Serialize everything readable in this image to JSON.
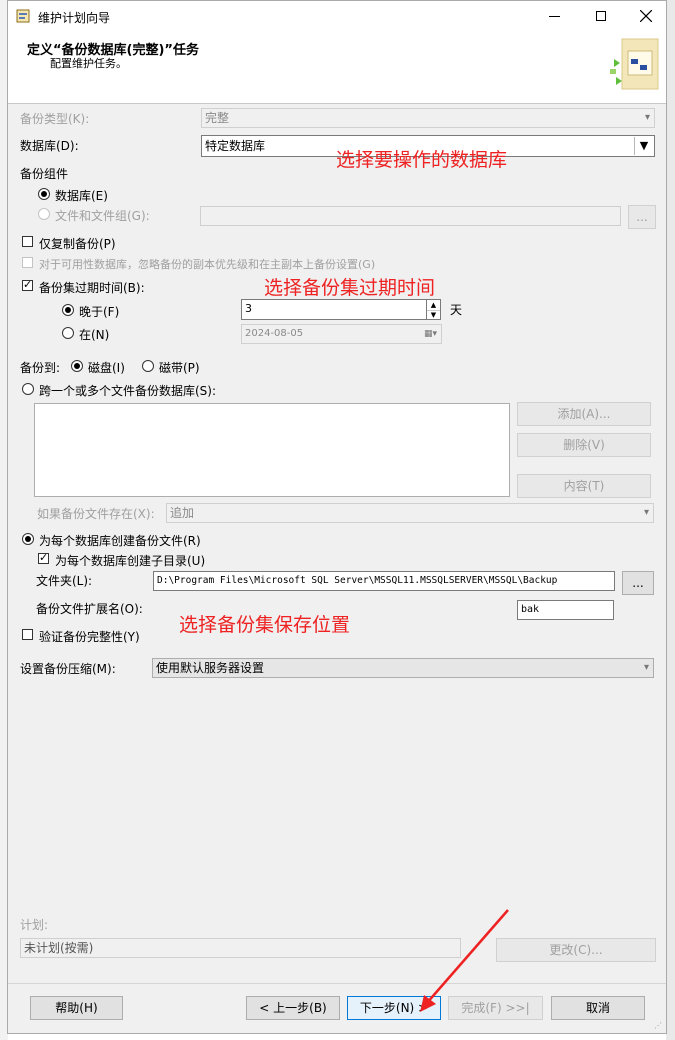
{
  "window": {
    "title": "维护计划向导",
    "header_title": "定义“备份数据库(完整)”任务",
    "header_subtitle": "配置维护任务。"
  },
  "backup_type": {
    "label": "备份类型(K):",
    "value": "完整"
  },
  "database": {
    "label": "数据库(D):",
    "value": "特定数据库"
  },
  "components": {
    "label": "备份组件",
    "database": "数据库(E)",
    "files": "文件和文件组(G):",
    "files_browse": "..."
  },
  "copy_only": "仅复制备份(P)",
  "availability": "对于可用性数据库，忽略备份的副本优先级和在主副本上备份设置(G)",
  "expire": {
    "label": "备份集过期时间(B):",
    "after_label": "晚于(F)",
    "after_value": "3",
    "after_unit": "天",
    "on_label": "在(N)",
    "on_value": "2024-08-05"
  },
  "backup_to": {
    "label": "备份到:",
    "disk": "磁盘(I)",
    "tape": "磁带(P)"
  },
  "span": {
    "label": "跨一个或多个文件备份数据库(S):",
    "add": "添加(A)...",
    "remove": "删除(V)",
    "contents": "内容(T)",
    "if_exists_label": "如果备份文件存在(X):",
    "if_exists_value": "追加"
  },
  "per_db": {
    "label": "为每个数据库创建备份文件(R)",
    "subdir": "为每个数据库创建子目录(U)",
    "folder_label": "文件夹(L):",
    "folder_value": "D:\\Program Files\\Microsoft SQL Server\\MSSQL11.MSSQLSERVER\\MSSQL\\Backup",
    "folder_browse": "...",
    "ext_label": "备份文件扩展名(O):",
    "ext_value": "bak"
  },
  "verify": "验证备份完整性(Y)",
  "compression": {
    "label": "设置备份压缩(M):",
    "value": "使用默认服务器设置"
  },
  "schedule": {
    "label": "计划:",
    "value": "未计划(按需)",
    "change": "更改(C)..."
  },
  "buttons": {
    "help": "帮助(H)",
    "back": "< 上一步(B)",
    "next": "下一步(N) >",
    "finish": "完成(F) >>|",
    "cancel": "取消"
  },
  "annotations": {
    "select_db": "选择要操作的数据库",
    "select_expire": "选择备份集过期时间",
    "select_location": "选择备份集保存位置"
  },
  "colors": {
    "annotation": "#ee2222",
    "focus": "#0078d7"
  }
}
